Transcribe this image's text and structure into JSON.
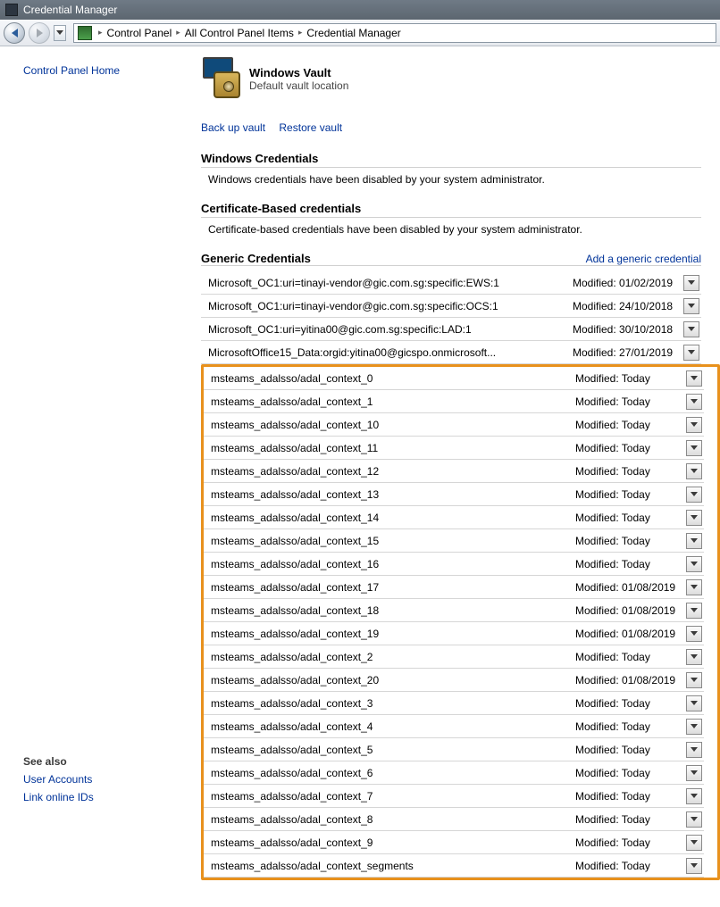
{
  "window": {
    "title": "Credential Manager"
  },
  "breadcrumb": {
    "items": [
      "Control Panel",
      "All Control Panel Items",
      "Credential Manager"
    ]
  },
  "sidebar": {
    "home": "Control Panel Home",
    "see_also_label": "See also",
    "see_also": [
      "User Accounts",
      "Link online IDs"
    ]
  },
  "vault": {
    "title": "Windows Vault",
    "subtitle": "Default vault location"
  },
  "actions": {
    "backup": "Back up vault",
    "restore": "Restore vault"
  },
  "sections": {
    "windows": {
      "title": "Windows Credentials",
      "desc": "Windows credentials have been disabled by your system administrator."
    },
    "cert": {
      "title": "Certificate-Based credentials",
      "desc": "Certificate-based credentials have been disabled by your system administrator."
    },
    "generic": {
      "title": "Generic Credentials",
      "add_label": "Add a generic credential"
    }
  },
  "modified_prefix": "Modified: ",
  "generic_top": [
    {
      "name": "Microsoft_OC1:uri=tinayi-vendor@gic.com.sg:specific:EWS:1",
      "modified": "01/02/2019"
    },
    {
      "name": "Microsoft_OC1:uri=tinayi-vendor@gic.com.sg:specific:OCS:1",
      "modified": "24/10/2018"
    },
    {
      "name": "Microsoft_OC1:uri=yitina00@gic.com.sg:specific:LAD:1",
      "modified": "30/10/2018"
    },
    {
      "name": "MicrosoftOffice15_Data:orgid:yitina00@gicspo.onmicrosoft...",
      "modified": "27/01/2019"
    }
  ],
  "generic_highlight": [
    {
      "name": "msteams_adalsso/adal_context_0",
      "modified": "Today"
    },
    {
      "name": "msteams_adalsso/adal_context_1",
      "modified": "Today"
    },
    {
      "name": "msteams_adalsso/adal_context_10",
      "modified": "Today"
    },
    {
      "name": "msteams_adalsso/adal_context_11",
      "modified": "Today"
    },
    {
      "name": "msteams_adalsso/adal_context_12",
      "modified": "Today"
    },
    {
      "name": "msteams_adalsso/adal_context_13",
      "modified": "Today"
    },
    {
      "name": "msteams_adalsso/adal_context_14",
      "modified": "Today"
    },
    {
      "name": "msteams_adalsso/adal_context_15",
      "modified": "Today"
    },
    {
      "name": "msteams_adalsso/adal_context_16",
      "modified": "Today"
    },
    {
      "name": "msteams_adalsso/adal_context_17",
      "modified": "01/08/2019"
    },
    {
      "name": "msteams_adalsso/adal_context_18",
      "modified": "01/08/2019"
    },
    {
      "name": "msteams_adalsso/adal_context_19",
      "modified": "01/08/2019"
    },
    {
      "name": "msteams_adalsso/adal_context_2",
      "modified": "Today"
    },
    {
      "name": "msteams_adalsso/adal_context_20",
      "modified": "01/08/2019"
    },
    {
      "name": "msteams_adalsso/adal_context_3",
      "modified": "Today"
    },
    {
      "name": "msteams_adalsso/adal_context_4",
      "modified": "Today"
    },
    {
      "name": "msteams_adalsso/adal_context_5",
      "modified": "Today"
    },
    {
      "name": "msteams_adalsso/adal_context_6",
      "modified": "Today"
    },
    {
      "name": "msteams_adalsso/adal_context_7",
      "modified": "Today"
    },
    {
      "name": "msteams_adalsso/adal_context_8",
      "modified": "Today"
    },
    {
      "name": "msteams_adalsso/adal_context_9",
      "modified": "Today"
    },
    {
      "name": "msteams_adalsso/adal_context_segments",
      "modified": "Today"
    }
  ]
}
